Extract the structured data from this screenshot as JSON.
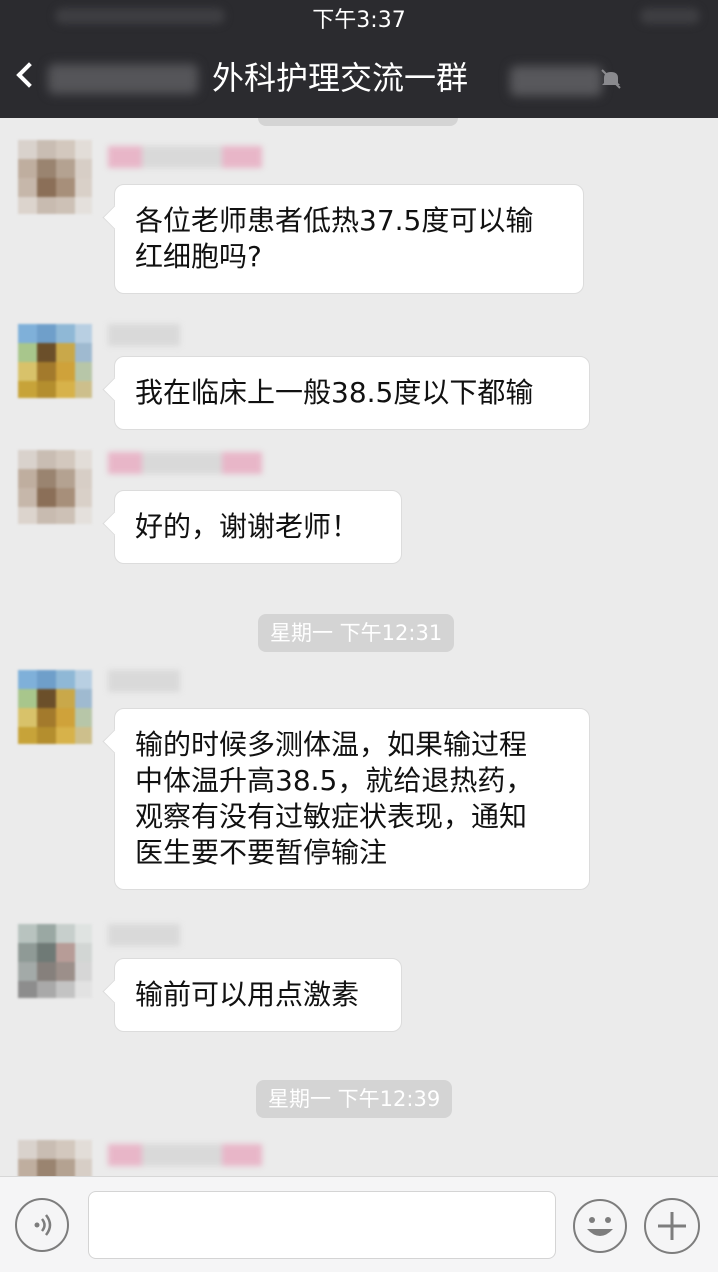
{
  "status_bar": {
    "time": "下午3:37"
  },
  "nav": {
    "title": "外科护理交流一群"
  },
  "messages": [
    {
      "text": "各位老师患者低热37.5度可以输\n红细胞吗?"
    },
    {
      "text": "我在临床上一般38.5度以下都输"
    },
    {
      "text": "好的，谢谢老师！"
    },
    {
      "text": "输的时候多测体温，如果输过程\n中体温升高38.5，就给退热药，\n观察有没有过敏症状表现，通知\n医生要不要暂停输注"
    },
    {
      "text": "输前可以用点激素"
    }
  ],
  "timestamps": [
    {
      "text": "星期一 下午12:31"
    },
    {
      "text": "星期一 下午12:39"
    }
  ],
  "input_bar": {
    "voice_icon": "voice-icon",
    "emoji_icon": "emoji-icon",
    "plus_icon": "plus-icon"
  },
  "colors": {
    "header_bg": "#2b2b2f",
    "chat_bg": "#ebebeb",
    "bubble_bg": "#ffffff",
    "timestamp_bg": "#d4d4d4"
  }
}
